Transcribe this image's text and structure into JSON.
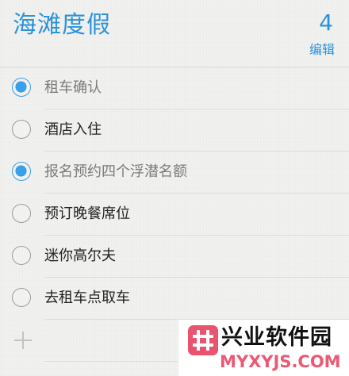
{
  "list": {
    "title": "海滩度假",
    "count": "4",
    "edit_label": "编辑"
  },
  "items": [
    {
      "label": "租车确认",
      "completed": true
    },
    {
      "label": "酒店入住",
      "completed": false
    },
    {
      "label": "报名预约四个浮潜名额",
      "completed": true
    },
    {
      "label": "预订晚餐席位",
      "completed": false
    },
    {
      "label": "迷你高尔夫",
      "completed": false
    },
    {
      "label": "去租车点取车",
      "completed": false
    }
  ],
  "add_row": {
    "icon": "plus-icon"
  },
  "watermark": {
    "name": "兴业软件园",
    "domain": "MYXYJS.COM",
    "logo_color": "#e8546f"
  },
  "colors": {
    "accent": "#2a93d9",
    "checked_fill": "#39a1ea"
  }
}
